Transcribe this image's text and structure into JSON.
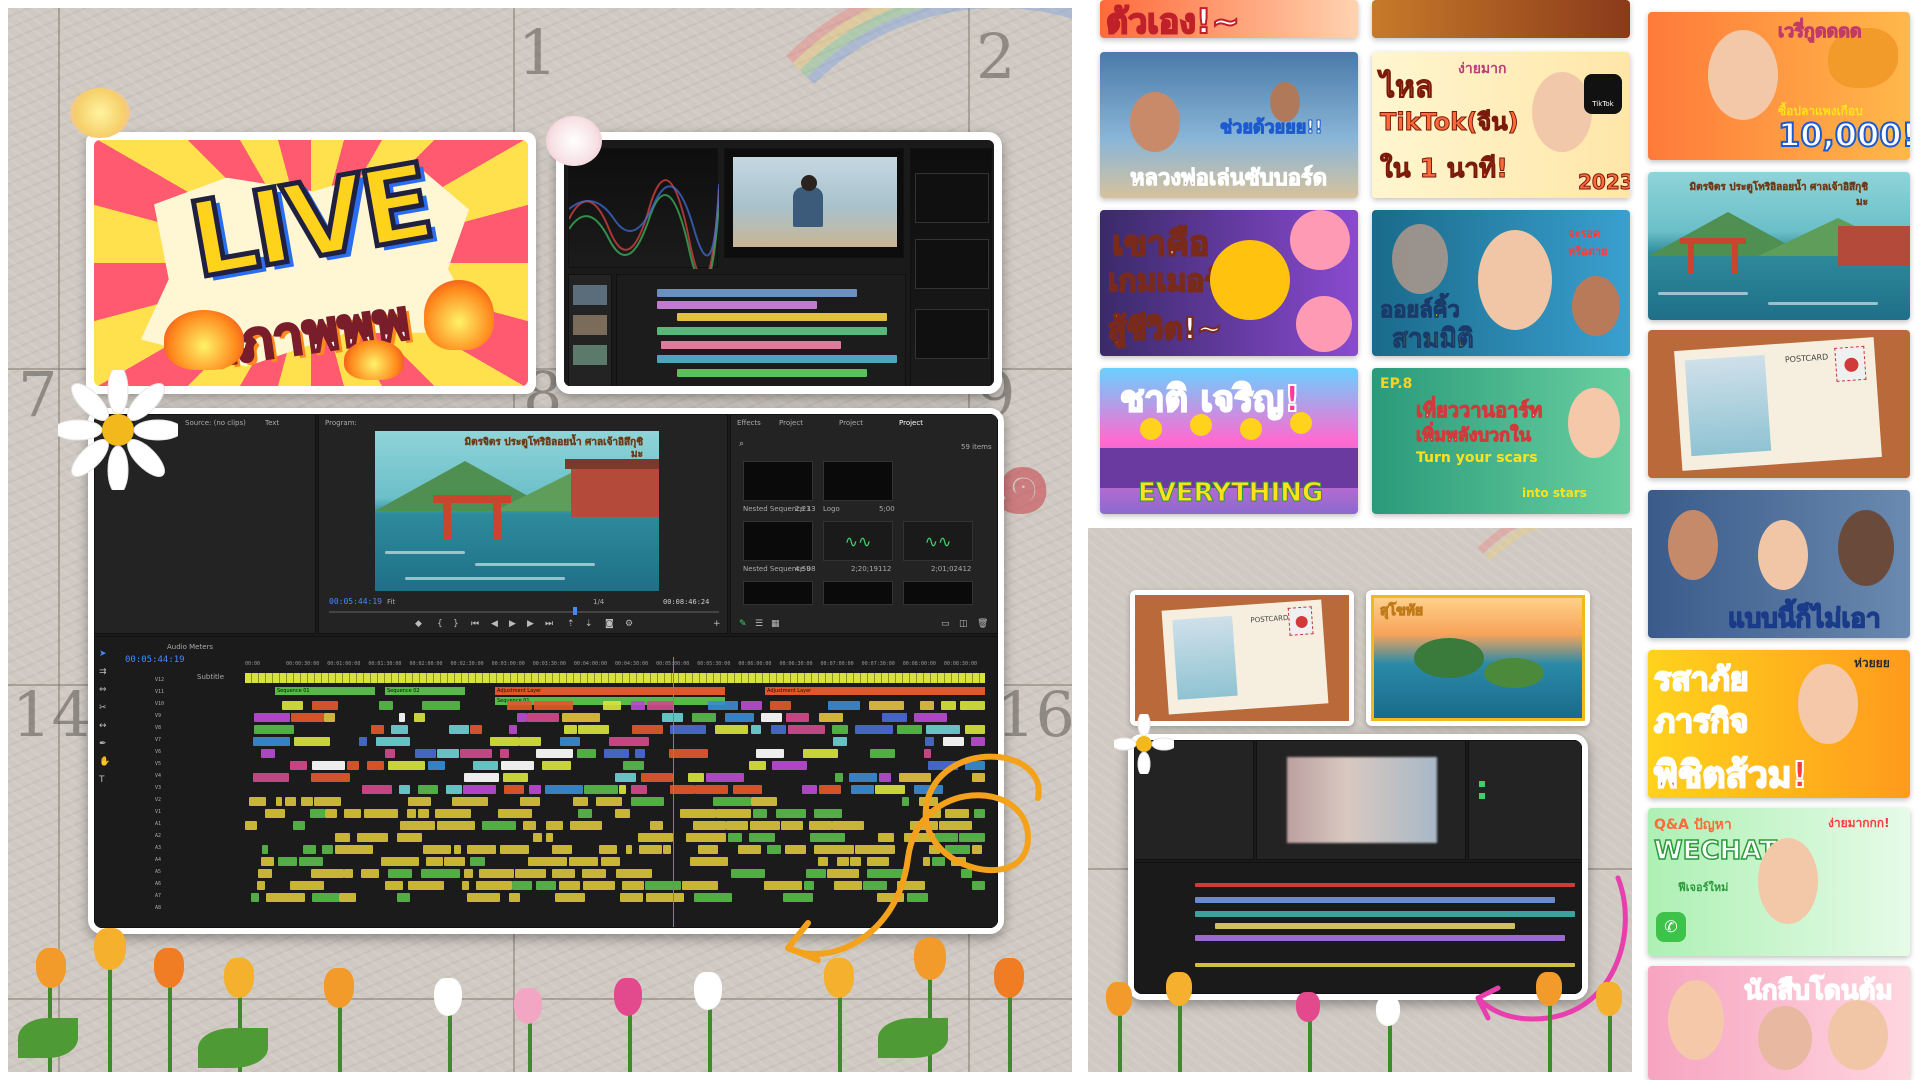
{
  "left_collage": {
    "calendar_numbers": [
      "1",
      "2",
      "7",
      "8",
      "9",
      "14",
      "16"
    ],
    "calendar_marks": [
      "๑",
      "๑"
    ],
    "live_thumbnail": {
      "word": "LIVE",
      "thai_text": "สภาพพพ"
    },
    "editor_big": {
      "source_label": "Source: (no clips)",
      "text_tab": "Text",
      "program_label": "Program:",
      "effects_tab": "Effects",
      "project_tab_1": "Project",
      "project_tab_2": "Project",
      "project_tab_3": "Project",
      "items_count": "59 items",
      "program_timecode": "00:05:44:19",
      "fit_label": "Fit",
      "scale_label": "1/4",
      "duration_timecode": "00:08:46:24",
      "audio_meters_label": "Audio Meters",
      "sequence_timecode": "00:05:44:19",
      "subtitle_label": "Subtitle",
      "bins": [
        {
          "name": "Nested Sequence 13",
          "dur": "2;23"
        },
        {
          "name": "Logo",
          "dur": "5;00"
        },
        {
          "name": "Nested Sequence 08",
          "dur": "4;59"
        },
        {
          "name": "",
          "dur": "2;20;19112"
        },
        {
          "name": "",
          "dur": "2;01;02412"
        }
      ],
      "ruler_ticks": [
        "00:00",
        "00:00:30:00",
        "00:01:00:00",
        "00:01:30:00",
        "00:02:00:00",
        "00:02:30:00",
        "00:03:00:00",
        "00:03:30:00",
        "00:04:00:00",
        "00:04:30:00",
        "00:05:00:00",
        "00:05:30:00",
        "00:06:00:00",
        "00:06:30:00",
        "00:07:00:00",
        "00:07:30:00",
        "00:08:00:00",
        "00:08:30:00"
      ],
      "track_labels": [
        "V12",
        "V11",
        "V10",
        "V9",
        "V8",
        "V7",
        "V6",
        "V5",
        "V4",
        "V3",
        "V2",
        "V1",
        "A1",
        "A2",
        "A3",
        "A4",
        "A5",
        "A6",
        "A7",
        "A8"
      ],
      "clip_labels": [
        "Sequence 01",
        "Sequence 02",
        "Adjustment Layer",
        "Sequence 01",
        "Adjustment Layer"
      ],
      "program_title": "มิตรจิตร ประตูโทริอิลอยน้ำ ศาลเจ้าอิสึกุชิมะ"
    }
  },
  "middle_column": {
    "thumbs": [
      {
        "caption": "ตัวเอง!~"
      },
      {
        "caption": "ช่วยด้วยยย!!",
        "caption2": "หลวงพ่อเล่นซับบอร์ด"
      },
      {
        "caption": "ไหล",
        "caption2": "TikTok(จีน)",
        "caption3": "ใน 1 นาที!",
        "caption4": "ง่ายมาก",
        "year": "2023",
        "brand": "TikTok"
      },
      {
        "caption": "เขาคือ",
        "caption2": "เกมเมอร์",
        "caption3": "สู้ชีวิต!~"
      },
      {
        "caption": "ออยล์คิ้ว",
        "caption2": "สามมิติ",
        "caption3": "จะรอด หรือตาย"
      },
      {
        "caption": "ชาติ เจริญ!",
        "caption2": "EVERYTHING"
      },
      {
        "caption": "EP.8",
        "caption2": "เที่ยววานอาร์ท",
        "caption3": "เพิ่มพลังบวกใน",
        "caption4": "Turn your scars",
        "caption5": "into stars"
      }
    ]
  },
  "middle_collage": {
    "postcard_label": "POSTCARD",
    "island_caption": "สุโขทัย"
  },
  "right_column": {
    "thumbs": [
      {
        "caption": "เวรี่กูดดดด",
        "caption2": "ซื้อปลาแพงเกือบ",
        "caption3": "10,000!!!"
      },
      {
        "caption": "มิตรจิตร ประตูโทริอิลอยน้ำ ศาลเจ้าอิสึกุชิมะ"
      },
      {
        "caption": "POSTCARD"
      },
      {
        "caption": "แบบนี้ก็ไม่เอา"
      },
      {
        "caption": "รสาภัย",
        "caption2": "ภารกิจ",
        "caption3": "พิชิตส้วม!",
        "caption4": "ห่วยยย"
      },
      {
        "caption": "Q&A ปัญหา",
        "caption2": "WECHAT",
        "caption3": "ง่ายมากกก!",
        "caption4": "ฟีเจอร์ใหม่"
      },
      {
        "caption": "นักสืบโดนต้ม"
      }
    ]
  },
  "colors": {
    "accent_orange": "#f4a21c",
    "accent_pink": "#e83fae",
    "premiere_blue": "#3f8cff"
  }
}
